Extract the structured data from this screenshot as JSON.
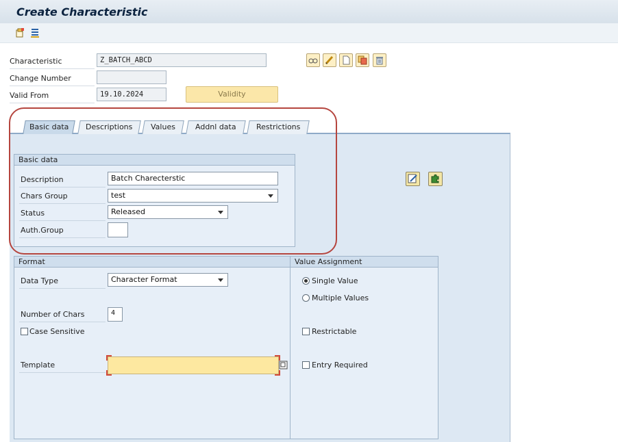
{
  "window": {
    "title": "Create Characteristic"
  },
  "toolbar": {
    "icons": [
      "new-document-icon",
      "hierarchy-icon"
    ]
  },
  "header": {
    "characteristic_label": "Characteristic",
    "characteristic_value": "Z_BATCH_ABCD",
    "change_number_label": "Change Number",
    "change_number_value": "",
    "valid_from_label": "Valid From",
    "valid_from_value": "19.10.2024",
    "validity_button": "Validity",
    "action_icons": [
      "display-icon",
      "edit-pencil-icon",
      "create-document-icon",
      "copy-icon",
      "delete-trash-icon"
    ]
  },
  "tabs": [
    {
      "label": "Basic data",
      "active": true
    },
    {
      "label": "Descriptions",
      "active": false
    },
    {
      "label": "Values",
      "active": false
    },
    {
      "label": "Addnl data",
      "active": false
    },
    {
      "label": "Restrictions",
      "active": false
    }
  ],
  "basic_data": {
    "group_title": "Basic data",
    "description_label": "Description",
    "description_value": "Batch Charecterstic",
    "chars_group_label": "Chars Group",
    "chars_group_value": "test",
    "status_label": "Status",
    "status_value": "Released",
    "auth_group_label": "Auth.Group",
    "auth_group_value": ""
  },
  "format": {
    "group_title": "Format",
    "data_type_label": "Data Type",
    "data_type_value": "Character Format",
    "num_chars_label": "Number of Chars",
    "num_chars_value": "4",
    "case_sensitive_label": "Case Sensitive",
    "case_sensitive_checked": false,
    "template_label": "Template",
    "template_value": ""
  },
  "value_assignment": {
    "group_title": "Value Assignment",
    "single_value_label": "Single Value",
    "multiple_values_label": "Multiple Values",
    "selected": "single",
    "restrictable_label": "Restrictable",
    "entry_required_label": "Entry Required"
  },
  "colors": {
    "highlight": "#b5453e",
    "panel": "#dde8f3",
    "template_field": "#fde8a0"
  }
}
